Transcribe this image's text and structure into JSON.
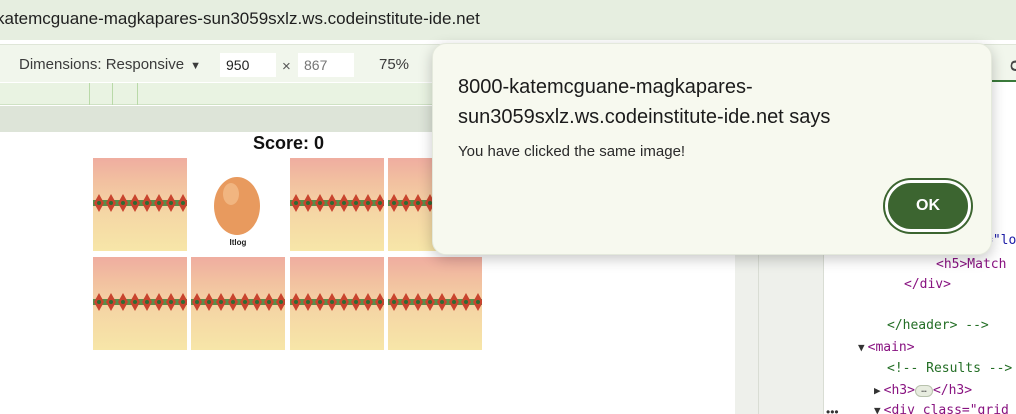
{
  "browser": {
    "url": "katemcguane-magkapares-sun3059sxlz.ws.codeinstitute-ide.net"
  },
  "device_toolbar": {
    "dimensions_label": "Dimensions: Responsive",
    "width_value": "950",
    "height_placeholder": "867",
    "separator": "×",
    "zoom_label": "75%",
    "right_fragment": "C"
  },
  "page": {
    "score_text": "Score: 0",
    "egg_label": "Itlog"
  },
  "devtools": {
    "tab_fragment": "C",
    "lines": {
      "l1": "=\"lo",
      "l2_tag": "<h5>Match",
      "l3": "</div>",
      "l4": "</header> -->",
      "l5": "<main>",
      "l6": "<!-- Results -->",
      "l7_open": "<h3>",
      "l7_ellipsis": "…",
      "l7_close": "</h3>",
      "l8": "<div class=\"grid"
    },
    "more_dots": "•••"
  },
  "dialog": {
    "title": "8000-katemcguane-magkapares-sun3059sxlz.ws.codeinstitute-ide.net says",
    "message": "You have clicked the same image!",
    "ok_label": "OK"
  },
  "colors": {
    "ok_button": "#3c6530",
    "addressbar_bg": "#e6eee0",
    "card_top": "#efada0",
    "card_bottom": "#f7e6a8"
  }
}
